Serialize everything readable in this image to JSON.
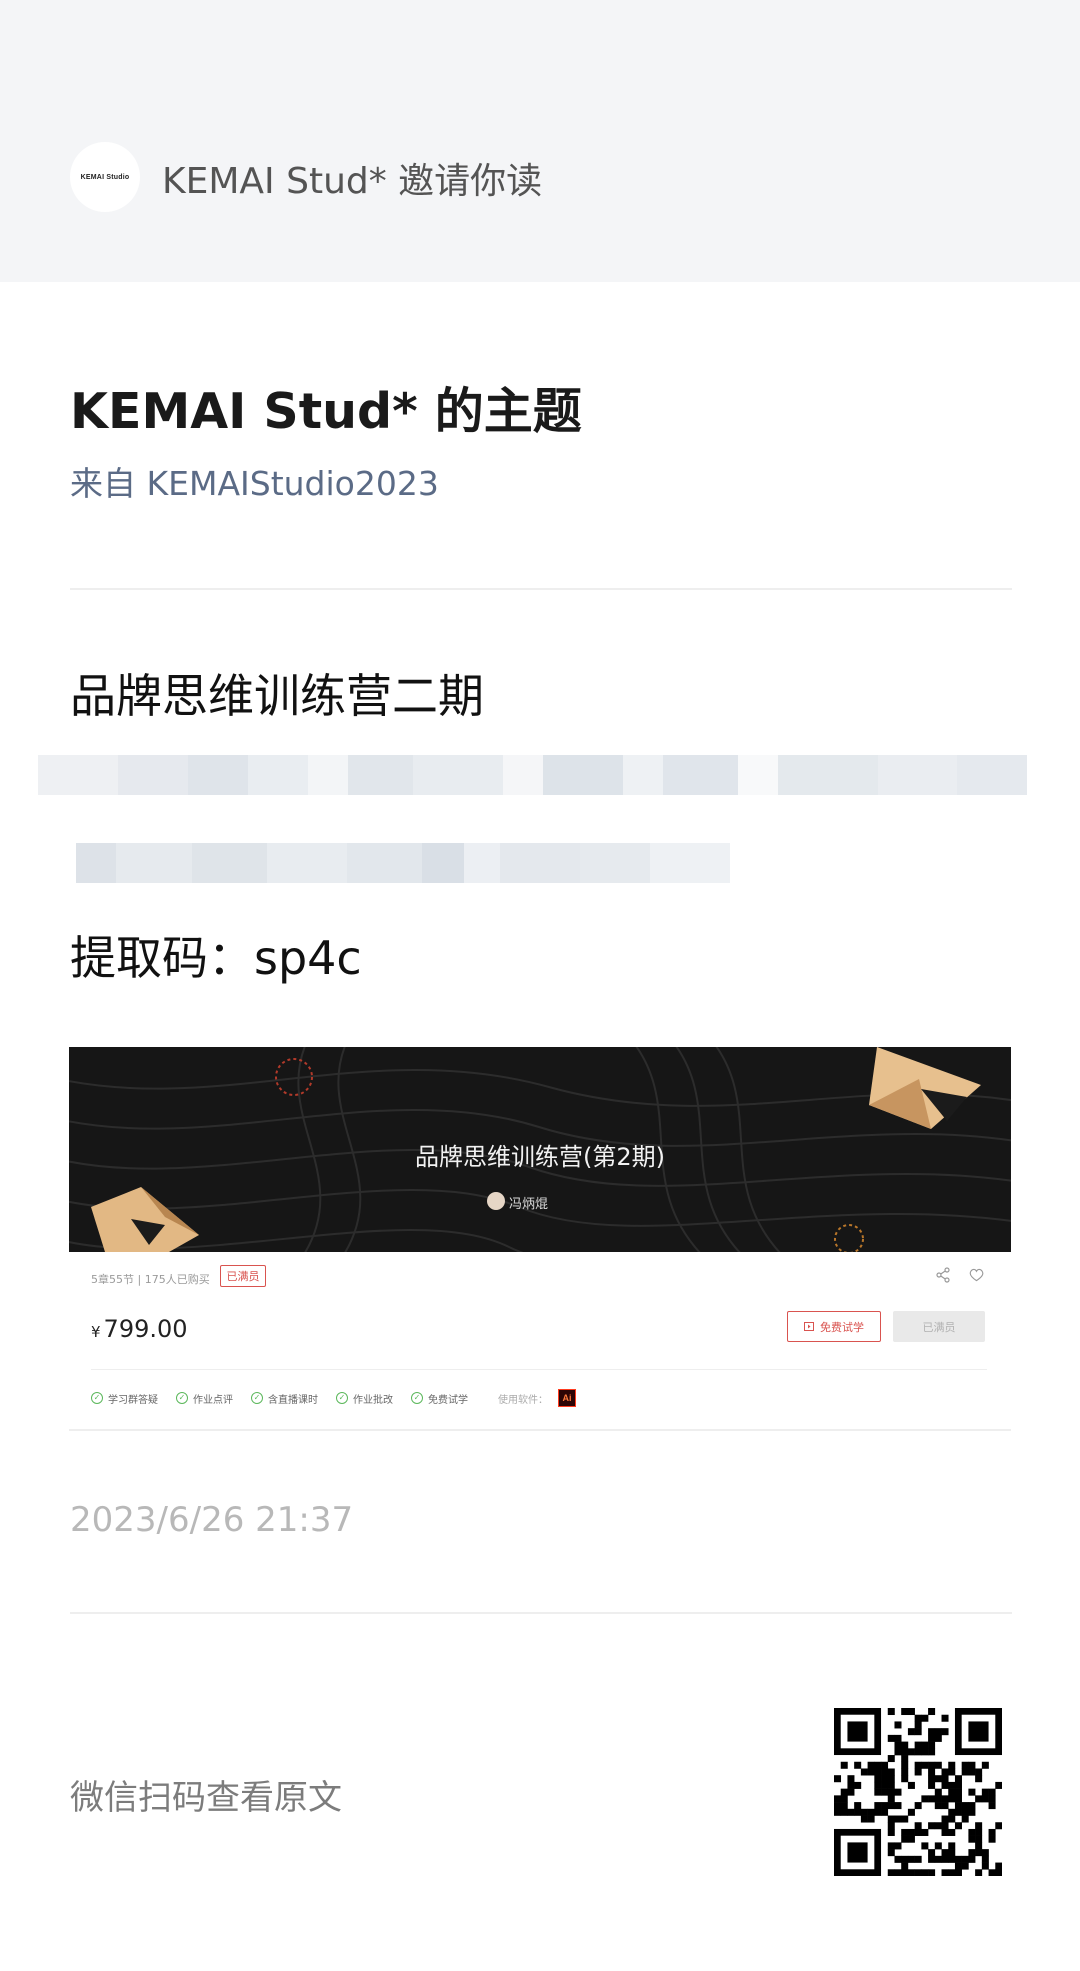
{
  "invite": {
    "avatar_text": "KEMAI Studio",
    "text": "KEMAI Stud* 邀请你读"
  },
  "topic": {
    "title": "KEMAI Stud* 的主题",
    "source": "来自 KEMAIStudio2023"
  },
  "post": {
    "title": "品牌思维训练营二期",
    "code_line": "提取码：sp4c"
  },
  "course_screenshot": {
    "title": "品牌思维训练营(第2期)",
    "author": "冯炳焜",
    "meta": "5章55节 | 175人已购买",
    "member_tag": "已满员",
    "currency": "¥",
    "price": "799.00",
    "trial_button": "免费试学",
    "joined_button": "已满员",
    "features": [
      "学习群答疑",
      "作业点评",
      "含直播课时",
      "作业批改",
      "免费试学"
    ],
    "software_label": "使用软件：",
    "software_icon": "Ai"
  },
  "timestamp": "2023/6/26 21:37",
  "scan_label": "微信扫码查看原文",
  "colors": {
    "invite_bg": "#f4f5f7",
    "source_link": "#5b6b86",
    "banner_bg": "#161616",
    "accent_red": "#d9534f",
    "check_green": "#5cb85c"
  }
}
